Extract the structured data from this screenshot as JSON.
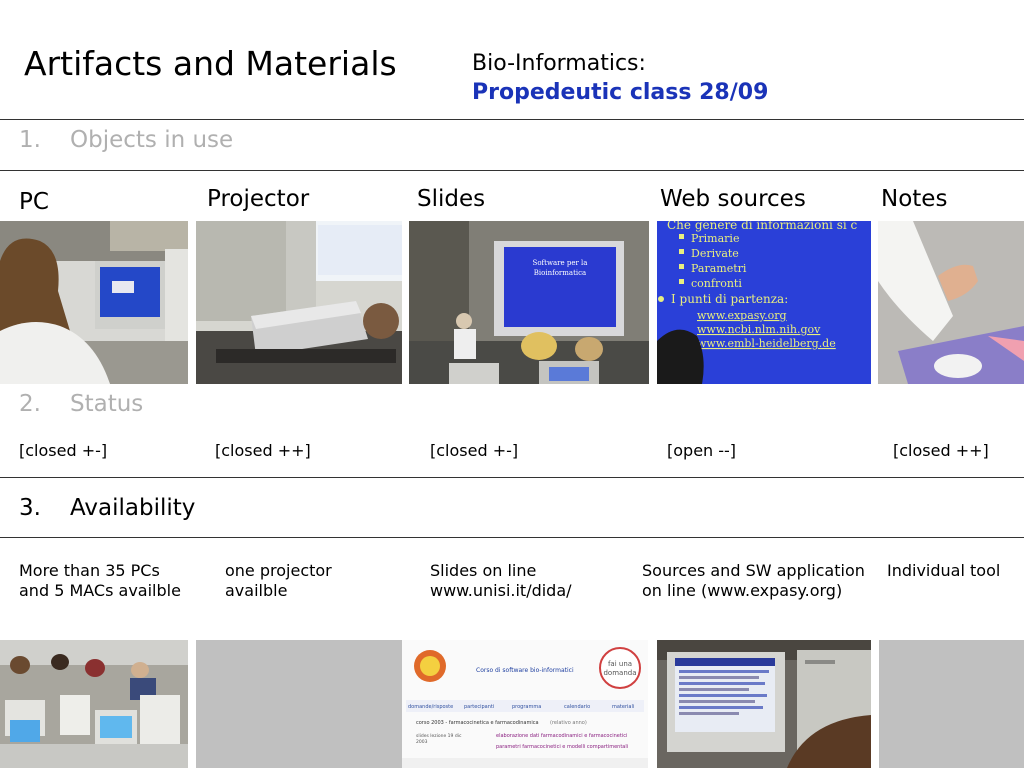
{
  "header": {
    "title": "Artifacts and Materials",
    "subtitle_line1": "Bio-Informatics:",
    "subtitle_line2": "Propedeutic class 28/09"
  },
  "sections": {
    "objects": {
      "num": "1.",
      "label": "Objects in use"
    },
    "status": {
      "num": "2.",
      "label": "Status"
    },
    "availability": {
      "num": "3.",
      "label": "Availability"
    }
  },
  "columns": [
    {
      "label": "PC",
      "status": "[closed +-]",
      "avail_line1": "More than 35 PCs",
      "avail_line2": "and 5 MACs availble"
    },
    {
      "label": "Projector",
      "status": "[closed ++]",
      "avail_line1": "one projector",
      "avail_line2": "availble"
    },
    {
      "label": "Slides",
      "status": "[closed +-]",
      "avail_line1": "Slides on line",
      "avail_line2": "www.unisi.it/dida/"
    },
    {
      "label": "Web sources",
      "status": "[open --]",
      "avail_line1": "Sources and SW application",
      "avail_line2": "on line (www.expasy.org)"
    },
    {
      "label": "Notes",
      "status": "[closed ++]",
      "avail_line1": "Individual tool",
      "avail_line2": ""
    }
  ],
  "photos": {
    "slides_screen_line1": "Software per la",
    "slides_screen_line2": "Bioinformatica",
    "web_lines": [
      "Che genere di informazioni si c",
      "Primarie",
      "Derivate",
      "Parametri",
      "confronti",
      "I punti di partenza:",
      "www.expasy.org",
      "www.ncbi.nlm.nih.gov",
      "www.embl-heidelberg.de"
    ],
    "site_heading": "Corso di software bio-informatici",
    "site_nav": [
      "domande/risposte",
      "partecipanti",
      "programma",
      "calendario",
      "materiali"
    ],
    "site_badge_line1": "fai una",
    "site_badge_line2": "domanda",
    "site_course": "corso 2003 - farmacocinetica e farmacodinamica",
    "site_course_note": "(relativo anno)",
    "site_date_line1": "slides lezione 19 dic",
    "site_date_line2": "2003",
    "site_link1": "elaborazione dati farmacodinamici e farmacocinetici",
    "site_link2": "parametri farmacocinetici e modelli compartimentali"
  },
  "colors": {
    "rule": "#333333",
    "accent": "#1a33b8",
    "muted": "#b0b0b0",
    "placeholder": "#c0c0c0"
  }
}
